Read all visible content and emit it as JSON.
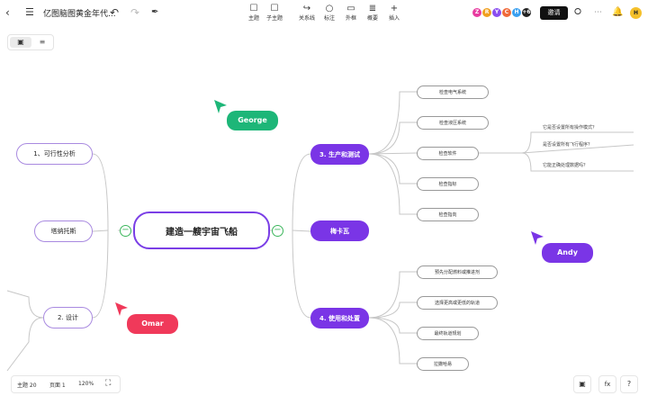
{
  "header": {
    "back_icon": "chevron-left-icon",
    "menu_icon": "hamburger-icon",
    "doc_title": "亿图脑图黄金年代...",
    "undo_icon": "undo-icon",
    "redo_icon": "redo-icon",
    "format_painter_icon": "format-painter-icon",
    "tools": [
      {
        "label": "主题",
        "icon": "topic-icon"
      },
      {
        "label": "子主题",
        "icon": "subtopic-icon"
      },
      {
        "label": "关系线",
        "icon": "relation-line-icon"
      },
      {
        "label": "标注",
        "icon": "callout-icon"
      },
      {
        "label": "外框",
        "icon": "boundary-icon"
      },
      {
        "label": "概要",
        "icon": "summary-icon"
      },
      {
        "label": "插入",
        "icon": "plus-icon"
      }
    ],
    "collaborators": [
      "Z",
      "R",
      "Y",
      "C",
      "H"
    ],
    "collaborator_colors": [
      "#e83ca0",
      "#f0a020",
      "#8a4ef0",
      "#f06a3a",
      "#3aa0f0"
    ],
    "more_count": "+6",
    "invite_label": "邀请",
    "share_icon": "share-icon",
    "bell_icon": "bell-icon",
    "user_initial": "H"
  },
  "view_toggle": {
    "mindmap_icon": "mindmap-view-icon",
    "outline_icon": "outline-view-icon"
  },
  "mindmap": {
    "root": "建造一艘宇宙飞船",
    "left": [
      {
        "label": "1、可行性分析"
      },
      {
        "label": "塔纳托斯"
      },
      {
        "label": "2. 设计"
      }
    ],
    "right": [
      {
        "label": "3. 生产和测试",
        "children": [
          "检查电气系统",
          "检查液压系统",
          "检查软件",
          "检查指标",
          "检查指向"
        ]
      },
      {
        "label": "梅卡瓦",
        "children": []
      },
      {
        "label": "4. 使用和处置",
        "children": [
          "预先分配燃料或推进剂",
          "选择更高或更低的轨道",
          "最终轨道规划",
          "拉撒哈易"
        ]
      }
    ],
    "notes": [
      "它是否设置所有操作模式？",
      "是否设置所有飞行程序？",
      "它能正确处理数据吗？"
    ]
  },
  "cursors": [
    {
      "name": "George",
      "color": "#1db678"
    },
    {
      "name": "Andy",
      "color": "#7a35e6"
    },
    {
      "name": "Omar",
      "color": "#f0395a"
    }
  ],
  "status_bar": {
    "topics": "主题 20",
    "pages": "页面 1",
    "zoom": "120%",
    "fullscreen_icon": "fullscreen-icon"
  },
  "bottom_right": {
    "present_icon": "presentation-icon",
    "formula_icon": "formula-icon",
    "help_icon": "help-icon"
  }
}
